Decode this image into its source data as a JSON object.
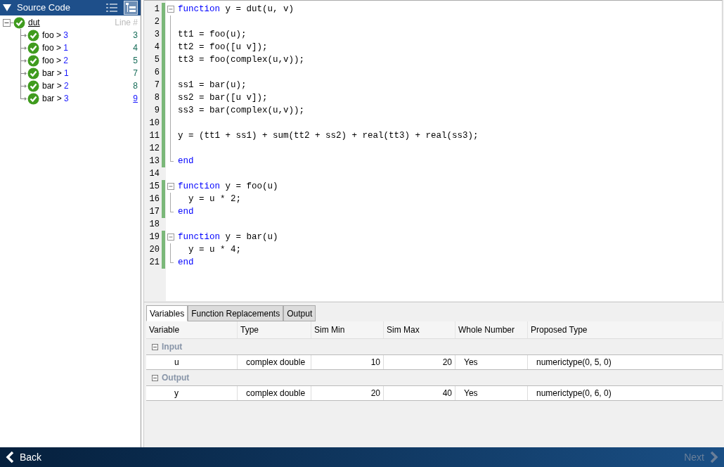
{
  "source_panel": {
    "title": "Source Code",
    "line_header": "Line #",
    "root": {
      "label": "dut",
      "underlined": true,
      "passed": true,
      "children": [
        {
          "name": "foo",
          "separator": ">",
          "index": "3",
          "line": "3",
          "underlined": false,
          "passed": true
        },
        {
          "name": "foo",
          "separator": ">",
          "index": "1",
          "line": "4",
          "underlined": false,
          "passed": true
        },
        {
          "name": "foo",
          "separator": ">",
          "index": "2",
          "line": "5",
          "underlined": false,
          "passed": true
        },
        {
          "name": "bar",
          "separator": ">",
          "index": "1",
          "line": "7",
          "underlined": false,
          "passed": true
        },
        {
          "name": "bar",
          "separator": ">",
          "index": "2",
          "line": "8",
          "underlined": false,
          "passed": true
        },
        {
          "name": "bar",
          "separator": ">",
          "index": "3",
          "line": "9",
          "underlined": true,
          "passed": true
        }
      ]
    }
  },
  "editor": {
    "lines": [
      {
        "number": "1",
        "covered": true,
        "kind": "fold_start",
        "segments": [
          {
            "kind": "keyword",
            "text": "function"
          },
          {
            "kind": "plain",
            "text": " y = dut(u, v)"
          }
        ]
      },
      {
        "number": "2",
        "covered": true,
        "kind": "fold_mid"
      },
      {
        "number": "3",
        "covered": true,
        "kind": "fold_mid",
        "segments": [
          {
            "kind": "plain",
            "text": "tt1 = foo(u);"
          }
        ]
      },
      {
        "number": "4",
        "covered": true,
        "kind": "fold_mid",
        "segments": [
          {
            "kind": "plain",
            "text": "tt2 = foo([u v]);"
          }
        ]
      },
      {
        "number": "5",
        "covered": true,
        "kind": "fold_mid",
        "segments": [
          {
            "kind": "plain",
            "text": "tt3 = foo(complex(u,v));"
          }
        ]
      },
      {
        "number": "6",
        "covered": true,
        "kind": "fold_mid"
      },
      {
        "number": "7",
        "covered": true,
        "kind": "fold_mid",
        "segments": [
          {
            "kind": "plain",
            "text": "ss1 = bar(u);"
          }
        ]
      },
      {
        "number": "8",
        "covered": true,
        "kind": "fold_mid",
        "segments": [
          {
            "kind": "plain",
            "text": "ss2 = bar([u v]);"
          }
        ]
      },
      {
        "number": "9",
        "covered": true,
        "kind": "fold_mid",
        "segments": [
          {
            "kind": "plain",
            "text": "ss3 = bar(complex(u,v));"
          }
        ]
      },
      {
        "number": "10",
        "covered": true,
        "kind": "fold_mid"
      },
      {
        "number": "11",
        "covered": true,
        "kind": "fold_mid",
        "segments": [
          {
            "kind": "plain",
            "text": "y = (tt1 + ss1) + sum(tt2 + ss2) + real(tt3) + real(ss3);"
          }
        ]
      },
      {
        "number": "12",
        "covered": true,
        "kind": "fold_mid"
      },
      {
        "number": "13",
        "covered": true,
        "kind": "fold_end",
        "segments": [
          {
            "kind": "keyword",
            "text": "end"
          }
        ]
      },
      {
        "number": "14",
        "covered": false,
        "kind": "plain"
      },
      {
        "number": "15",
        "covered": true,
        "kind": "fold_start",
        "segments": [
          {
            "kind": "keyword",
            "text": "function"
          },
          {
            "kind": "plain",
            "text": " y = foo(u)"
          }
        ]
      },
      {
        "number": "16",
        "covered": true,
        "kind": "fold_mid",
        "segments": [
          {
            "kind": "plain",
            "text": "  y = u * 2;"
          }
        ]
      },
      {
        "number": "17",
        "covered": true,
        "kind": "fold_end",
        "segments": [
          {
            "kind": "keyword",
            "text": "end"
          }
        ]
      },
      {
        "number": "18",
        "covered": false,
        "kind": "plain"
      },
      {
        "number": "19",
        "covered": true,
        "kind": "fold_start",
        "segments": [
          {
            "kind": "keyword",
            "text": "function"
          },
          {
            "kind": "plain",
            "text": " y = bar(u)"
          }
        ]
      },
      {
        "number": "20",
        "covered": true,
        "kind": "fold_mid",
        "segments": [
          {
            "kind": "plain",
            "text": "  y = u * 4;"
          }
        ]
      },
      {
        "number": "21",
        "covered": true,
        "kind": "fold_end",
        "segments": [
          {
            "kind": "keyword",
            "text": "end"
          }
        ]
      }
    ]
  },
  "tabs": [
    {
      "label": "Variables",
      "selected": true
    },
    {
      "label": "Function Replacements",
      "selected": false
    },
    {
      "label": "Output",
      "selected": false
    }
  ],
  "table": {
    "columns": [
      "Variable",
      "Type",
      "Sim Min",
      "Sim Max",
      "Whole Number",
      "Proposed Type"
    ],
    "groups": [
      {
        "label": "Input",
        "expanded": true,
        "rows": [
          [
            "u",
            "complex double",
            "10",
            "20",
            "Yes",
            "numerictype(0, 5, 0)"
          ]
        ]
      },
      {
        "label": "Output",
        "expanded": true,
        "rows": [
          [
            "y",
            "complex double",
            "20",
            "40",
            "Yes",
            "numerictype(0, 6, 0)"
          ]
        ]
      }
    ]
  },
  "footer": {
    "back": {
      "label": "Back",
      "disabled": false
    },
    "next": {
      "label": "Next",
      "disabled": true
    }
  }
}
